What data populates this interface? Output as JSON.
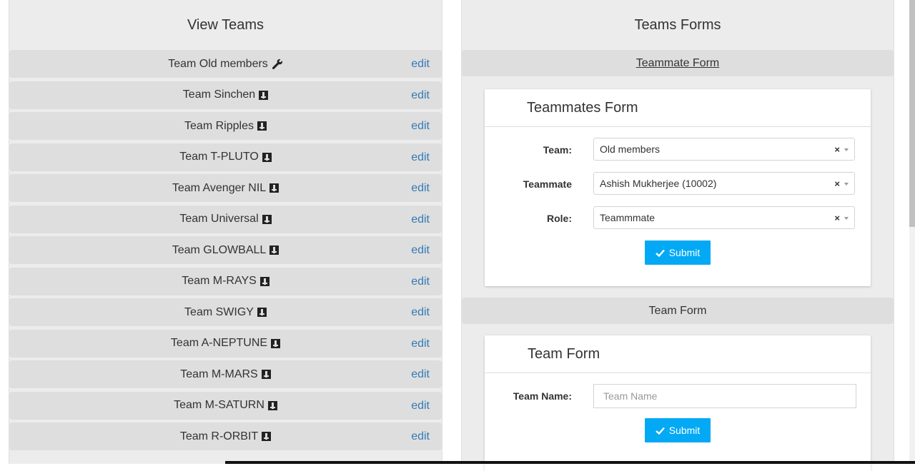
{
  "left": {
    "title": "View Teams",
    "edit_label": "edit",
    "teams": [
      {
        "name": "Team Old members",
        "icon": "wrench-icon"
      },
      {
        "name": "Team Sinchen",
        "icon": "badge-icon"
      },
      {
        "name": "Team Ripples",
        "icon": "badge-icon"
      },
      {
        "name": "Team T-PLUTO",
        "icon": "badge-icon"
      },
      {
        "name": "Team Avenger NIL",
        "icon": "badge-icon"
      },
      {
        "name": "Team Universal",
        "icon": "badge-icon"
      },
      {
        "name": "Team GLOWBALL",
        "icon": "badge-icon"
      },
      {
        "name": "Team M-RAYS",
        "icon": "badge-icon"
      },
      {
        "name": "Team SWIGY",
        "icon": "badge-icon"
      },
      {
        "name": "Team A-NEPTUNE",
        "icon": "badge-icon"
      },
      {
        "name": "Team M-MARS",
        "icon": "badge-icon"
      },
      {
        "name": "Team M-SATURN",
        "icon": "badge-icon"
      },
      {
        "name": "Team R-ORBIT",
        "icon": "badge-icon"
      }
    ]
  },
  "right": {
    "title": "Teams Forms",
    "teammate_section": {
      "header": "Teammate Form",
      "card_title": "Teammates Form",
      "team_label": "Team:",
      "team_value": "Old members",
      "teammate_label": "Teammate",
      "teammate_value": "Ashish Mukherjee (10002)",
      "role_label": "Role:",
      "role_value": "Teammmate",
      "clear_symbol": "×",
      "submit_label": "Submit"
    },
    "team_section": {
      "header": "Team Form",
      "card_title": "Team Form",
      "name_label": "Team Name:",
      "name_placeholder": "Team Name",
      "submit_label": "Submit"
    }
  },
  "colors": {
    "accent": "#03a9f4",
    "link": "#337ab7",
    "panel_bg": "#ececec",
    "row_bg": "#dedede"
  }
}
